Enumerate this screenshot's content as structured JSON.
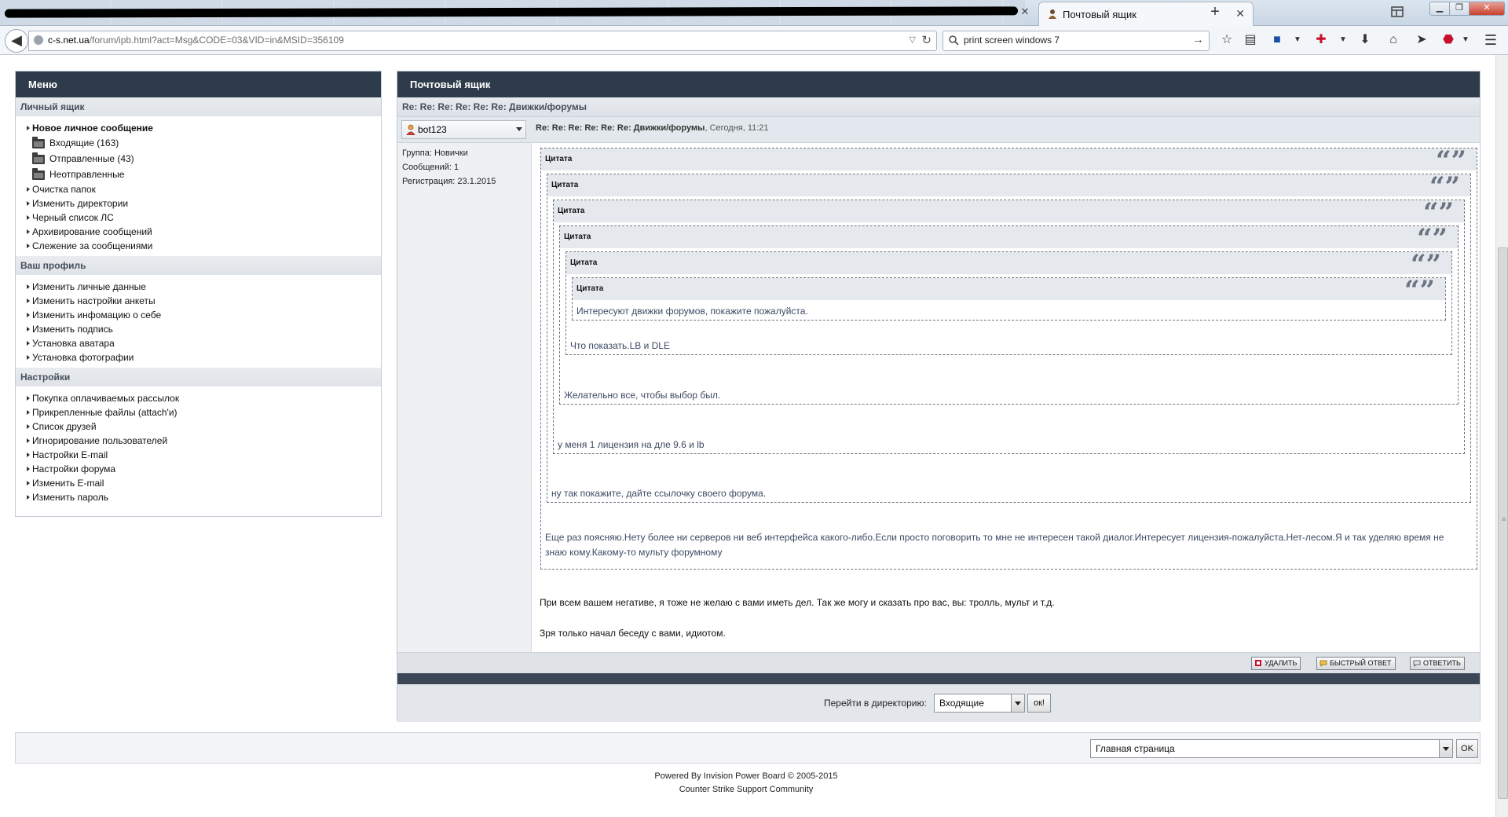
{
  "browser": {
    "active_tab_title": "Почтовый ящик",
    "url_host": "c-s.net.ua",
    "url_rest": "/forum/ipb.html?act=Msg&CODE=03&VID=in&MSID=356109",
    "search_value": "print screen windows 7"
  },
  "menu": {
    "title": "Меню",
    "sections": [
      {
        "title": "Личный ящик"
      },
      {
        "title": "Ваш профиль"
      },
      {
        "title": "Настройки"
      }
    ],
    "inbox": {
      "new_message": "Новое личное сообщение",
      "folders": [
        "Входящие (163)",
        "Отправленные (43)",
        "Неотправленные"
      ],
      "items": [
        "Очистка папок",
        "Изменить директории",
        "Черный список ЛС",
        "Архивирование сообщений",
        "Слежение за сообщениями"
      ]
    },
    "profile_items": [
      "Изменить личные данные",
      "Изменить настройки анкеты",
      "Изменить инфомацию о себе",
      "Изменить подпись",
      "Установка аватара",
      "Установка фотографии"
    ],
    "settings_items": [
      "Покупка оплачиваемых рассылок",
      "Прикрепленные файлы (attach'и)",
      "Список друзей",
      "Игнорирование пользователей",
      "Настройки E-mail",
      "Настройки форума",
      "Изменить E-mail",
      "Изменить пароль"
    ]
  },
  "mailbox": {
    "title": "Почтовый ящик",
    "subject": "Re: Re: Re: Re: Re: Re: Движки/форумы",
    "author": "bot123",
    "post_title": "Re: Re: Re: Re: Re: Re: Движки/форумы",
    "post_date": ", Сегодня, 11:21",
    "author_info": [
      "Группа: Новички",
      "Сообщений: 1",
      "Регистрация: 23.1.2015"
    ],
    "quote_label": "Цитата",
    "quotes": [
      "Интересуют движки форумов, покажите пожалуйста.",
      "Что показать.LB и DLE",
      "Желательно все, чтобы выбор был.",
      "у меня 1 лицензия на дле 9.6 и lb",
      "ну так покажите, дайте ссылочку своего форума.",
      "Еще раз поясняю.Нету более ни серверов ни веб интерфейса какого-либо.Если просто поговорить то мне не интересен такой диалог.Интересует лицензия-пожалуйста.Нет-лесом.Я и так уделяю время не знаю кому.Какому-то мульту форумному"
    ],
    "reply_paragraphs": [
      "При всем вашем негативе, я тоже не желаю с вами иметь дел. Так же могу и сказать про вас, вы: тролль, мульт и т.д.",
      "Зря только начал беседу с вами, идиотом."
    ],
    "buttons": {
      "delete": "УДАЛИТЬ",
      "quick_reply": "БЫСТРЫЙ ОТВЕТ",
      "reply": "ОТВЕТИТЬ"
    },
    "goto_label": "Перейти в директорию:",
    "goto_value": "Входящие",
    "goto_ok": "ок!"
  },
  "bottom": {
    "home_select": "Главная страница",
    "ok": "OK"
  },
  "credits": {
    "line1": "Powered By Invision Power Board  © 2005-2015",
    "line2": "Counter Strike Support Community"
  },
  "colors": {
    "panel_header": "#2e3b4b",
    "quote_text": "#3c4a63",
    "section_bg": "#e3e8ee"
  }
}
